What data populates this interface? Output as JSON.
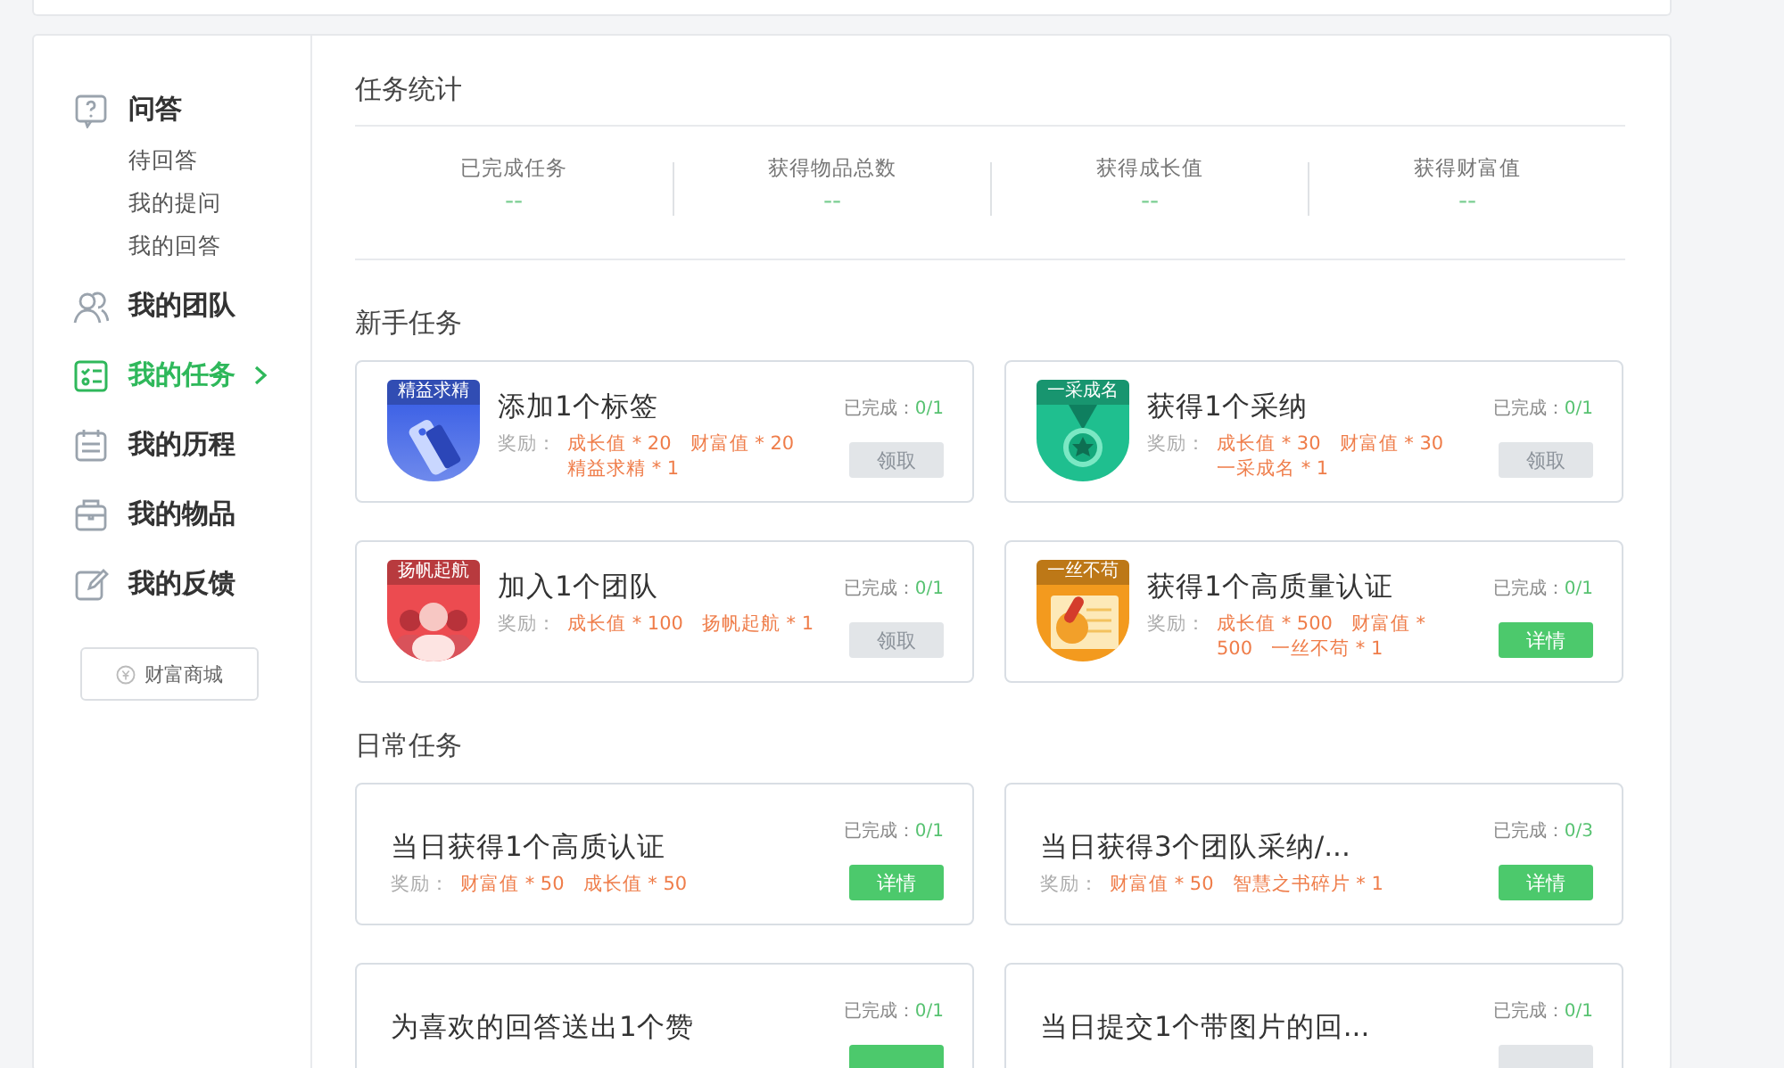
{
  "sidebar": {
    "items": [
      {
        "label": "问答",
        "selected": false,
        "children": [
          {
            "label": "待回答"
          },
          {
            "label": "我的提问"
          },
          {
            "label": "我的回答"
          }
        ]
      },
      {
        "label": "我的团队",
        "selected": false
      },
      {
        "label": "我的任务",
        "selected": true
      },
      {
        "label": "我的历程",
        "selected": false
      },
      {
        "label": "我的物品",
        "selected": false
      },
      {
        "label": "我的反馈",
        "selected": false
      }
    ],
    "shop_button": "财富商城"
  },
  "stats": {
    "title": "任务统计",
    "items": [
      {
        "label": "已完成任务",
        "value": "--"
      },
      {
        "label": "获得物品总数",
        "value": "--"
      },
      {
        "label": "获得成长值",
        "value": "--"
      },
      {
        "label": "获得财富值",
        "value": "--"
      }
    ]
  },
  "sections": [
    {
      "title": "新手任务",
      "tasks": [
        {
          "badge": {
            "label": "精益求精",
            "color": "#3f63e6"
          },
          "title": "添加1个标签",
          "progress_label": "已完成：",
          "progress": "0/1",
          "reward_label": "奖励：",
          "rewards": [
            "成长值 * 20",
            "财富值 * 20",
            "精益求精 * 1"
          ],
          "button": {
            "label": "领取",
            "disabled": true
          }
        },
        {
          "badge": {
            "label": "一采成名",
            "color": "#1fbf8f"
          },
          "title": "获得1个采纳",
          "progress_label": "已完成：",
          "progress": "0/1",
          "reward_label": "奖励：",
          "rewards": [
            "成长值 * 30",
            "财富值 * 30",
            "一采成名 * 1"
          ],
          "button": {
            "label": "领取",
            "disabled": true
          }
        },
        {
          "badge": {
            "label": "扬帆起航",
            "color": "#ec4b50"
          },
          "title": "加入1个团队",
          "progress_label": "已完成：",
          "progress": "0/1",
          "reward_label": "奖励：",
          "rewards": [
            "成长值 * 100",
            "扬帆起航 * 1"
          ],
          "button": {
            "label": "领取",
            "disabled": true
          }
        },
        {
          "badge": {
            "label": "一丝不苟",
            "color": "#f39a1e"
          },
          "title": "获得1个高质量认证",
          "progress_label": "已完成：",
          "progress": "0/1",
          "reward_label": "奖励：",
          "rewards": [
            "成长值 * 500",
            "财富值 * 500",
            "一丝不苟 * 1"
          ],
          "button": {
            "label": "详情",
            "disabled": false
          }
        }
      ]
    },
    {
      "title": "日常任务",
      "tasks": [
        {
          "title": "当日获得1个高质认证",
          "progress_label": "已完成：",
          "progress": "0/1",
          "reward_label": "奖励：",
          "rewards": [
            "财富值 * 50",
            "成长值 * 50"
          ],
          "button": {
            "label": "详情",
            "disabled": false
          }
        },
        {
          "title": "当日获得3个团队采纳/...",
          "progress_label": "已完成：",
          "progress": "0/3",
          "reward_label": "奖励：",
          "rewards": [
            "财富值 * 50",
            "智慧之书碎片 * 1"
          ],
          "button": {
            "label": "详情",
            "disabled": false
          }
        },
        {
          "title": "为喜欢的回答送出1个赞",
          "progress_label": "已完成：",
          "progress": "0/1",
          "button": {
            "disabled": false
          }
        },
        {
          "title": "当日提交1个带图片的回...",
          "progress_label": "已完成：",
          "progress": "0/1",
          "button": {
            "disabled": true
          }
        }
      ]
    }
  ]
}
